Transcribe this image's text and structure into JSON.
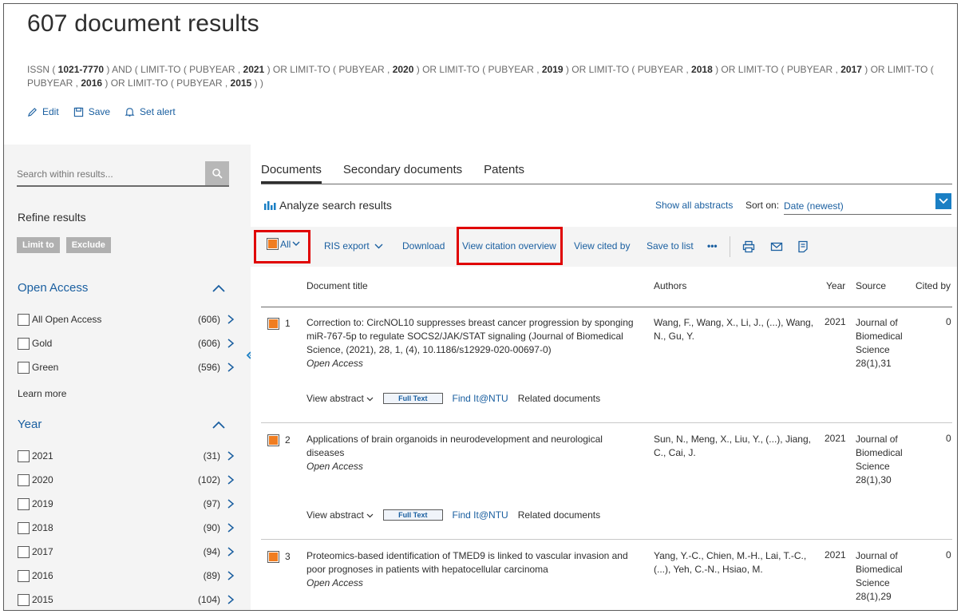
{
  "header": {
    "title": "607 document results",
    "query_parts": [
      {
        "t": "ISSN ( ",
        "b": false
      },
      {
        "t": "1021-7770",
        "b": true
      },
      {
        "t": " )  AND  ( LIMIT-TO ( PUBYEAR ,  ",
        "b": false
      },
      {
        "t": "2021",
        "b": true
      },
      {
        "t": " )  OR  LIMIT-TO ( PUBYEAR ,  ",
        "b": false
      },
      {
        "t": "2020",
        "b": true
      },
      {
        "t": " )  OR  LIMIT-TO ( PUBYEAR ,  ",
        "b": false
      },
      {
        "t": "2019",
        "b": true
      },
      {
        "t": " )  OR  LIMIT-TO ( PUBYEAR ,  ",
        "b": false
      },
      {
        "t": "2018",
        "b": true
      },
      {
        "t": " )  OR  LIMIT-TO ( PUBYEAR ,  ",
        "b": false
      },
      {
        "t": "2017",
        "b": true
      },
      {
        "t": " )  OR  LIMIT-TO ( PUBYEAR ,  ",
        "b": false
      },
      {
        "t": "2016",
        "b": true
      },
      {
        "t": " )  OR  LIMIT-TO ( PUBYEAR ,  ",
        "b": false
      },
      {
        "t": "2015",
        "b": true
      },
      {
        "t": " ) )",
        "b": false
      }
    ],
    "edit_label": "Edit",
    "save_label": "Save",
    "alert_label": "Set alert"
  },
  "sidebar": {
    "search_placeholder": "Search within results...",
    "refine_title": "Refine results",
    "limit_to": "Limit to",
    "exclude": "Exclude",
    "open_access": {
      "title": "Open Access",
      "items": [
        {
          "label": "All Open Access",
          "count": "(606)"
        },
        {
          "label": "Gold",
          "count": "(606)"
        },
        {
          "label": "Green",
          "count": "(596)"
        }
      ],
      "learn_more": "Learn more"
    },
    "year": {
      "title": "Year",
      "items": [
        {
          "label": "2021",
          "count": "(31)"
        },
        {
          "label": "2020",
          "count": "(102)"
        },
        {
          "label": "2019",
          "count": "(97)"
        },
        {
          "label": "2018",
          "count": "(90)"
        },
        {
          "label": "2017",
          "count": "(94)"
        },
        {
          "label": "2016",
          "count": "(89)"
        },
        {
          "label": "2015",
          "count": "(104)"
        }
      ]
    }
  },
  "main": {
    "tabs": [
      "Documents",
      "Secondary documents",
      "Patents"
    ],
    "analyze": "Analyze search results",
    "show_all_abstracts": "Show all abstracts",
    "sort_label": "Sort on:",
    "sort_value": "Date (newest)",
    "toolbar": {
      "all": "All",
      "ris_export": "RIS export",
      "download": "Download",
      "citation_overview": "View citation overview",
      "cited_by": "View cited by",
      "save_to_list": "Save to list",
      "more": "•••"
    },
    "columns": {
      "title": "Document title",
      "authors": "Authors",
      "year": "Year",
      "source": "Source",
      "cited": "Cited by"
    },
    "rows": [
      {
        "num": "1",
        "title": "Correction to: CircNOL10 suppresses breast cancer progression by sponging miR-767-5p to regulate SOCS2/JAK/STAT signaling (Journal of Biomedical Science, (2021), 28, 1, (4), 10.1186/s12929-020-00697-0)",
        "oa": "Open Access",
        "authors": "Wang, F., Wang, X., Li, J., (...), Wang, N., Gu, Y.",
        "year": "2021",
        "source": "Journal of Biomedical Science 28(1),31",
        "cited": "0"
      },
      {
        "num": "2",
        "title": "Applications of brain organoids in neurodevelopment and neurological diseases",
        "oa": "Open Access",
        "authors": "Sun, N., Meng, X., Liu, Y., (...), Jiang, C., Cai, J.",
        "year": "2021",
        "source": "Journal of Biomedical Science 28(1),30",
        "cited": "0"
      },
      {
        "num": "3",
        "title": "Proteomics-based identification of TMED9 is linked to vascular invasion and poor prognoses in patients with hepatocellular carcinoma",
        "oa": "Open Access",
        "authors": "Yang, Y.-C., Chien, M.-H., Lai, T.-C., (...), Yeh, C.-N., Hsiao, M.",
        "year": "2021",
        "source": "Journal of Biomedical Science 28(1),29",
        "cited": "0"
      }
    ],
    "row_links": {
      "view_abstract": "View abstract",
      "full_text": "Full Text",
      "find_it": "Find It@NTU",
      "related": "Related documents"
    }
  },
  "colors": {
    "link": "#1a5fa0",
    "checkbox_fill": "#f07d21",
    "highlight_box": "#e00000",
    "panel_bg": "#f4f4f4"
  }
}
